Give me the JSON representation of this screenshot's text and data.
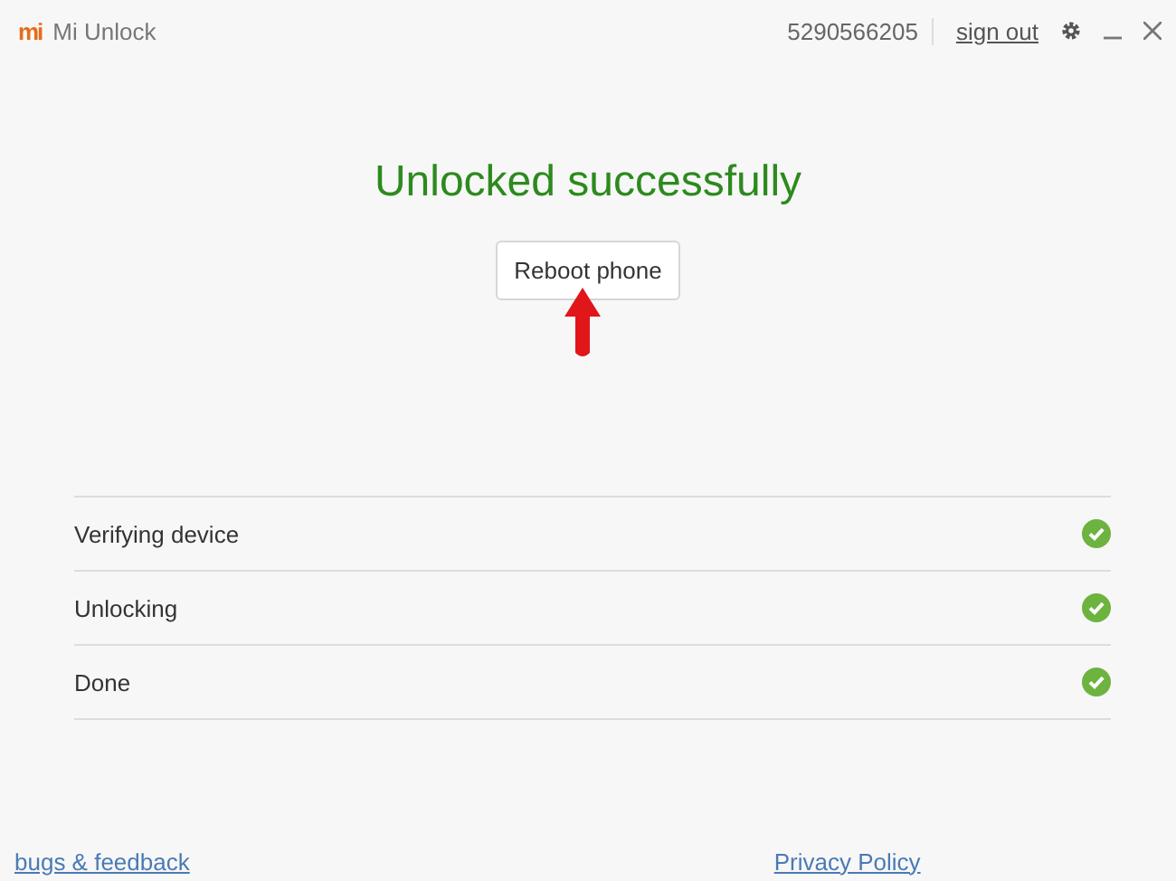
{
  "window": {
    "logo": "mi",
    "title": "Mi Unlock"
  },
  "account": {
    "id": "5290566205",
    "sign_out": "sign out"
  },
  "status": {
    "title": "Unlocked successfully",
    "button": "Reboot phone",
    "pointer": true
  },
  "steps": [
    {
      "label": "Verifying device",
      "kind": "done"
    },
    {
      "label": "Unlocking",
      "kind": "done"
    },
    {
      "label": "Done",
      "kind": "done"
    }
  ],
  "footer": {
    "left_link": "bugs & feedback",
    "right_link": "Privacy Policy"
  }
}
